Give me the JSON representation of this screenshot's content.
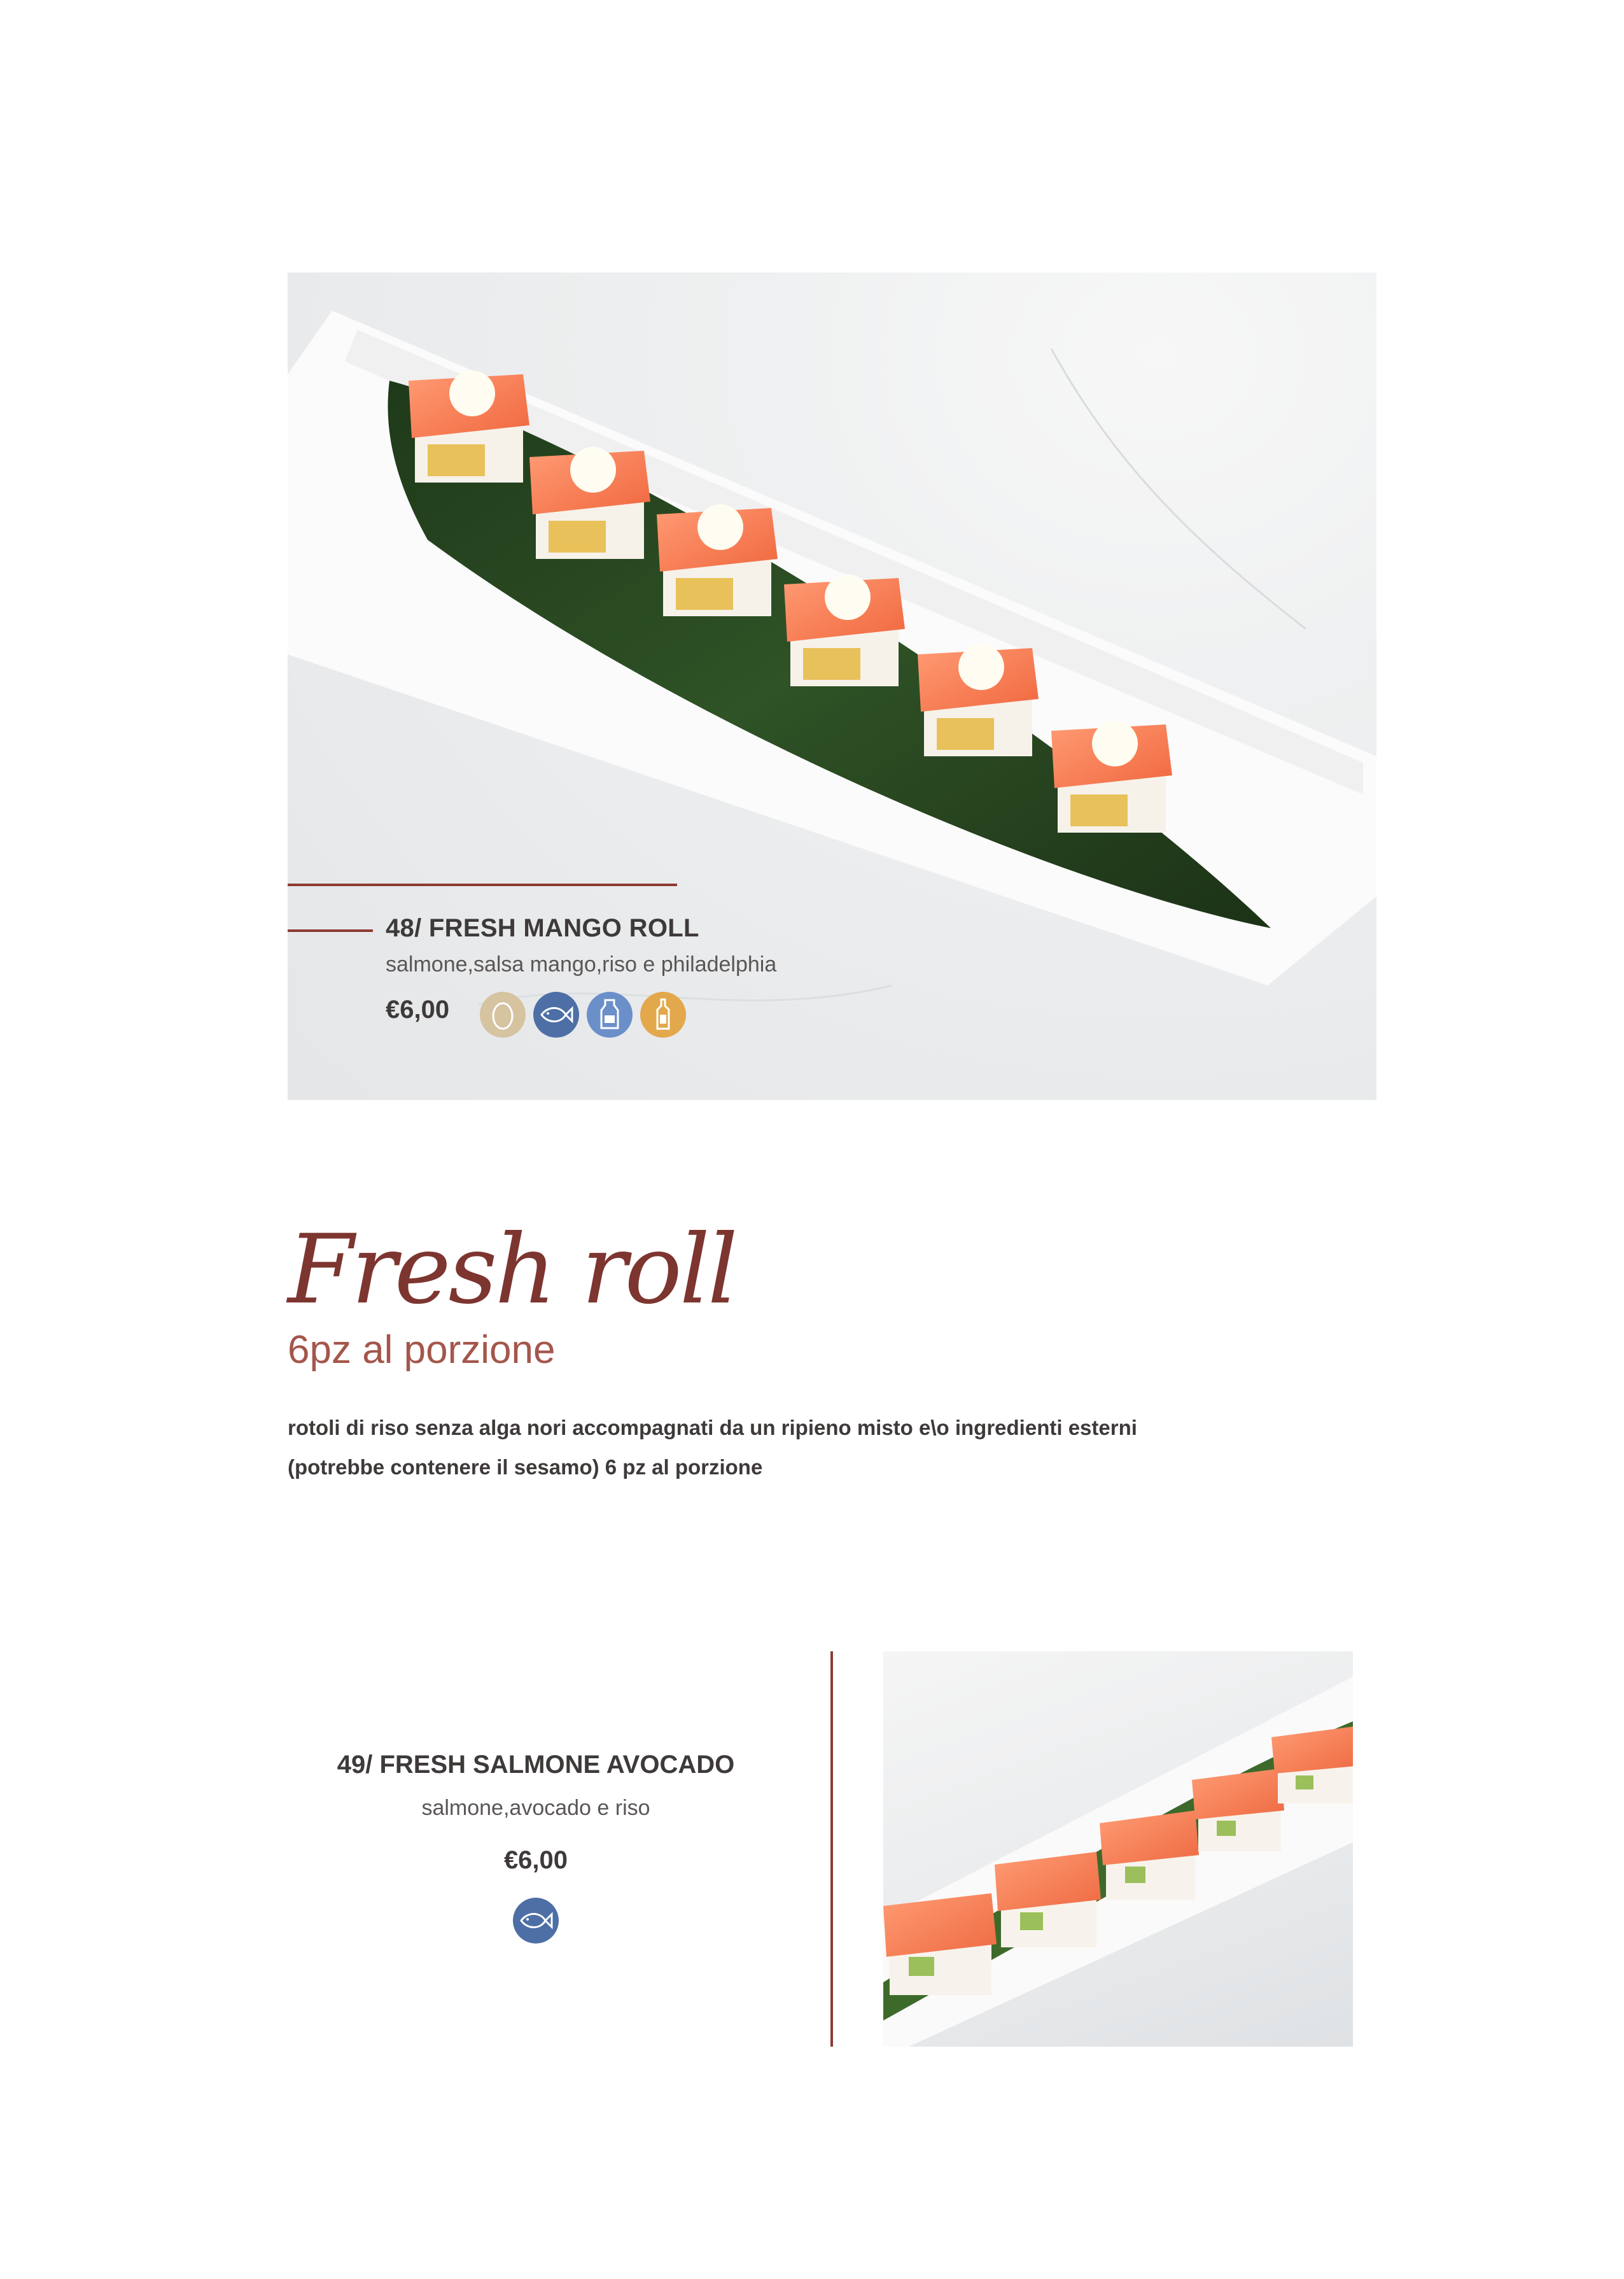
{
  "hero": {
    "item_title": "48/ FRESH MANGO ROLL",
    "item_desc": "salmone,salsa mango,riso e philadelphia",
    "item_price": "€6,00",
    "allergens": [
      {
        "icon": "egg-icon",
        "color": "#d6c3a0"
      },
      {
        "icon": "fish-icon",
        "color": "#4d6fa5"
      },
      {
        "icon": "milk-icon",
        "color": "#6b8fc9"
      },
      {
        "icon": "sauce-bottle-icon",
        "color": "#e2a84b"
      }
    ]
  },
  "section": {
    "title": "Fresh roll",
    "subtitle": "6pz al porzione",
    "desc_line1": "rotoli di riso senza alga nori accompagnati da un ripieno misto e\\o ingredienti esterni",
    "desc_line2": "(potrebbe contenere il  sesamo)  6 pz al porzione"
  },
  "item2": {
    "title": "49/ FRESH SALMONE AVOCADO",
    "desc": "salmone,avocado e riso",
    "price": "€6,00",
    "allergens": [
      {
        "icon": "fish-icon",
        "color": "#4d6fa5"
      }
    ]
  },
  "colors": {
    "accent": "#8e3a32",
    "title": "#7d3530",
    "subtitle": "#a4564b",
    "text": "#3e3a39"
  }
}
